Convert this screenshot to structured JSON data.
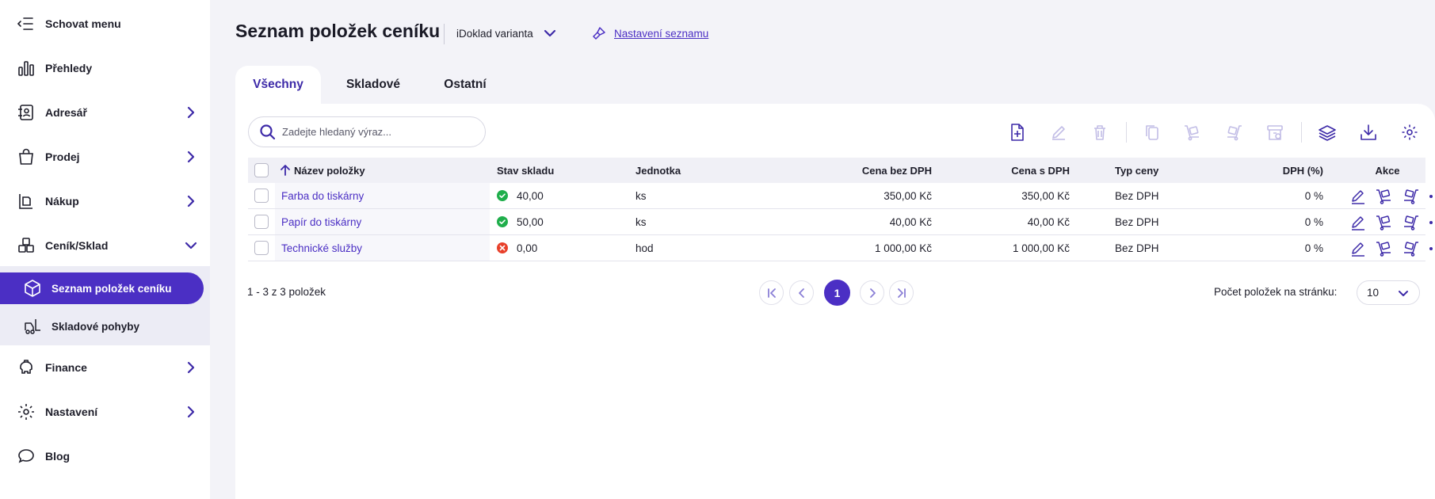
{
  "sidebar": {
    "items": [
      {
        "label": "Schovat menu",
        "icon": "hide-menu-icon"
      },
      {
        "label": "Přehledy",
        "icon": "bar-chart-icon"
      },
      {
        "label": "Adresář",
        "icon": "address-book-icon"
      },
      {
        "label": "Prodej",
        "icon": "shopping-bag-icon"
      },
      {
        "label": "Nákup",
        "icon": "purchase-icon"
      },
      {
        "label": "Ceník/Sklad",
        "icon": "boxes-icon"
      },
      {
        "label": "Finance",
        "icon": "piggy-bank-icon"
      },
      {
        "label": "Nastavení",
        "icon": "gear-icon"
      },
      {
        "label": "Blog",
        "icon": "chat-bubble-icon"
      }
    ],
    "subitems": [
      {
        "label": "Seznam položek ceníku",
        "icon": "box-icon",
        "active": true
      },
      {
        "label": "Skladové pohyby",
        "icon": "forklift-icon",
        "active": false
      }
    ]
  },
  "header": {
    "title": "Seznam položek ceníku",
    "variant": "iDoklad varianta",
    "settings_link": "Nastavení seznamu"
  },
  "tabs": [
    "Všechny",
    "Skladové",
    "Ostatní"
  ],
  "search": {
    "placeholder": "Zadejte hledaný výraz...",
    "value": ""
  },
  "table": {
    "columns": [
      "Název položky",
      "Stav skladu",
      "Jednotka",
      "Cena bez DPH",
      "Cena s DPH",
      "Typ ceny",
      "DPH (%)",
      "Akce"
    ],
    "rows": [
      {
        "name": "Farba do tiskárny",
        "stock": "40,00",
        "stock_status": "ok",
        "unit": "ks",
        "price": "350,00 Kč",
        "price_vat": "350,00 Kč",
        "price_type": "Bez DPH",
        "vat": "0 %"
      },
      {
        "name": "Papír do tiskárny",
        "stock": "50,00",
        "stock_status": "ok",
        "unit": "ks",
        "price": "40,00 Kč",
        "price_vat": "40,00 Kč",
        "price_type": "Bez DPH",
        "vat": "0 %"
      },
      {
        "name": "Technické služby",
        "stock": "0,00",
        "stock_status": "empty",
        "unit": "hod",
        "price": "1 000,00 Kč",
        "price_vat": "1 000,00 Kč",
        "price_type": "Bez DPH",
        "vat": "0 %"
      }
    ]
  },
  "pagination": {
    "range": "1 - 3 z 3 položek",
    "current_page": "1",
    "per_page_label": "Počet položek na stránku:",
    "per_page": "10"
  },
  "colors": {
    "accent": "#4b2fc4",
    "ok": "#1fae4b",
    "error": "#e8402a"
  }
}
